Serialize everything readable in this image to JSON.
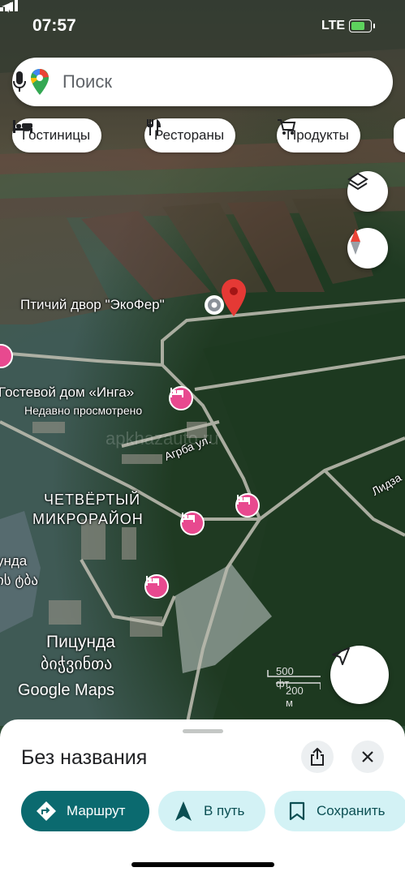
{
  "status_bar": {
    "time": "07:57",
    "network": "LTE"
  },
  "search": {
    "placeholder": "Поиск"
  },
  "chips": [
    {
      "label": "Гостиницы",
      "icon": "bed-icon"
    },
    {
      "label": "Рестораны",
      "icon": "fork-knife-icon"
    },
    {
      "label": "Продукты",
      "icon": "cart-icon"
    }
  ],
  "map": {
    "place_label": "Птичий двор \"ЭкоФер\"",
    "guest_house_label": "Гостевой дом «Инга»",
    "guest_house_sub": "Недавно просмотрено",
    "street_agrba": "Агрба ул.",
    "street_lidz": "Лидза",
    "district_line1": "ЧЕТВЁРТЫЙ",
    "district_line2": "МИКРОРАЙОН",
    "left_label1": "унда",
    "left_label2": "ის ტბა",
    "town_ru": "Пицунда",
    "town_ka": "ბიჭვინთა",
    "watermark": "apkhazauto.ru",
    "scale_ft": "500 фт.",
    "scale_m": "200 м",
    "attribution": "Google Maps"
  },
  "sheet": {
    "title": "Без названия",
    "actions": [
      {
        "label": "Маршрут",
        "icon": "directions-icon"
      },
      {
        "label": "В путь",
        "icon": "navigation-arrow-icon"
      },
      {
        "label": "Сохранить",
        "icon": "bookmark-icon"
      }
    ]
  },
  "colors": {
    "accent": "#0b6a6f",
    "chip_light": "#d3f2f5",
    "pin_red": "#e53935",
    "hotel_pink": "#e8498f"
  }
}
